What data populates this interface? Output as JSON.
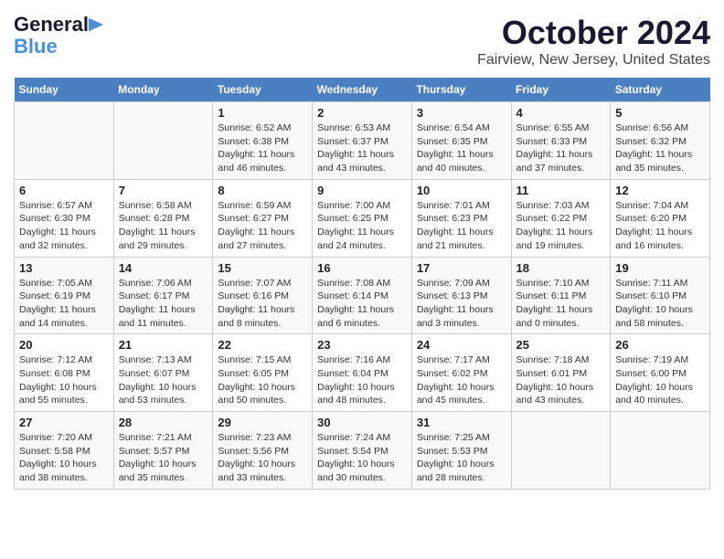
{
  "header": {
    "logo_line1": "General",
    "logo_line2": "Blue",
    "title": "October 2024",
    "subtitle": "Fairview, New Jersey, United States"
  },
  "days_of_week": [
    "Sunday",
    "Monday",
    "Tuesday",
    "Wednesday",
    "Thursday",
    "Friday",
    "Saturday"
  ],
  "weeks": [
    [
      {
        "day": "",
        "info": ""
      },
      {
        "day": "",
        "info": ""
      },
      {
        "day": "1",
        "info": "Sunrise: 6:52 AM\nSunset: 6:38 PM\nDaylight: 11 hours and 46 minutes."
      },
      {
        "day": "2",
        "info": "Sunrise: 6:53 AM\nSunset: 6:37 PM\nDaylight: 11 hours and 43 minutes."
      },
      {
        "day": "3",
        "info": "Sunrise: 6:54 AM\nSunset: 6:35 PM\nDaylight: 11 hours and 40 minutes."
      },
      {
        "day": "4",
        "info": "Sunrise: 6:55 AM\nSunset: 6:33 PM\nDaylight: 11 hours and 37 minutes."
      },
      {
        "day": "5",
        "info": "Sunrise: 6:56 AM\nSunset: 6:32 PM\nDaylight: 11 hours and 35 minutes."
      }
    ],
    [
      {
        "day": "6",
        "info": "Sunrise: 6:57 AM\nSunset: 6:30 PM\nDaylight: 11 hours and 32 minutes."
      },
      {
        "day": "7",
        "info": "Sunrise: 6:58 AM\nSunset: 6:28 PM\nDaylight: 11 hours and 29 minutes."
      },
      {
        "day": "8",
        "info": "Sunrise: 6:59 AM\nSunset: 6:27 PM\nDaylight: 11 hours and 27 minutes."
      },
      {
        "day": "9",
        "info": "Sunrise: 7:00 AM\nSunset: 6:25 PM\nDaylight: 11 hours and 24 minutes."
      },
      {
        "day": "10",
        "info": "Sunrise: 7:01 AM\nSunset: 6:23 PM\nDaylight: 11 hours and 21 minutes."
      },
      {
        "day": "11",
        "info": "Sunrise: 7:03 AM\nSunset: 6:22 PM\nDaylight: 11 hours and 19 minutes."
      },
      {
        "day": "12",
        "info": "Sunrise: 7:04 AM\nSunset: 6:20 PM\nDaylight: 11 hours and 16 minutes."
      }
    ],
    [
      {
        "day": "13",
        "info": "Sunrise: 7:05 AM\nSunset: 6:19 PM\nDaylight: 11 hours and 14 minutes."
      },
      {
        "day": "14",
        "info": "Sunrise: 7:06 AM\nSunset: 6:17 PM\nDaylight: 11 hours and 11 minutes."
      },
      {
        "day": "15",
        "info": "Sunrise: 7:07 AM\nSunset: 6:16 PM\nDaylight: 11 hours and 8 minutes."
      },
      {
        "day": "16",
        "info": "Sunrise: 7:08 AM\nSunset: 6:14 PM\nDaylight: 11 hours and 6 minutes."
      },
      {
        "day": "17",
        "info": "Sunrise: 7:09 AM\nSunset: 6:13 PM\nDaylight: 11 hours and 3 minutes."
      },
      {
        "day": "18",
        "info": "Sunrise: 7:10 AM\nSunset: 6:11 PM\nDaylight: 11 hours and 0 minutes."
      },
      {
        "day": "19",
        "info": "Sunrise: 7:11 AM\nSunset: 6:10 PM\nDaylight: 10 hours and 58 minutes."
      }
    ],
    [
      {
        "day": "20",
        "info": "Sunrise: 7:12 AM\nSunset: 6:08 PM\nDaylight: 10 hours and 55 minutes."
      },
      {
        "day": "21",
        "info": "Sunrise: 7:13 AM\nSunset: 6:07 PM\nDaylight: 10 hours and 53 minutes."
      },
      {
        "day": "22",
        "info": "Sunrise: 7:15 AM\nSunset: 6:05 PM\nDaylight: 10 hours and 50 minutes."
      },
      {
        "day": "23",
        "info": "Sunrise: 7:16 AM\nSunset: 6:04 PM\nDaylight: 10 hours and 48 minutes."
      },
      {
        "day": "24",
        "info": "Sunrise: 7:17 AM\nSunset: 6:02 PM\nDaylight: 10 hours and 45 minutes."
      },
      {
        "day": "25",
        "info": "Sunrise: 7:18 AM\nSunset: 6:01 PM\nDaylight: 10 hours and 43 minutes."
      },
      {
        "day": "26",
        "info": "Sunrise: 7:19 AM\nSunset: 6:00 PM\nDaylight: 10 hours and 40 minutes."
      }
    ],
    [
      {
        "day": "27",
        "info": "Sunrise: 7:20 AM\nSunset: 5:58 PM\nDaylight: 10 hours and 38 minutes."
      },
      {
        "day": "28",
        "info": "Sunrise: 7:21 AM\nSunset: 5:57 PM\nDaylight: 10 hours and 35 minutes."
      },
      {
        "day": "29",
        "info": "Sunrise: 7:23 AM\nSunset: 5:56 PM\nDaylight: 10 hours and 33 minutes."
      },
      {
        "day": "30",
        "info": "Sunrise: 7:24 AM\nSunset: 5:54 PM\nDaylight: 10 hours and 30 minutes."
      },
      {
        "day": "31",
        "info": "Sunrise: 7:25 AM\nSunset: 5:53 PM\nDaylight: 10 hours and 28 minutes."
      },
      {
        "day": "",
        "info": ""
      },
      {
        "day": "",
        "info": ""
      }
    ]
  ]
}
